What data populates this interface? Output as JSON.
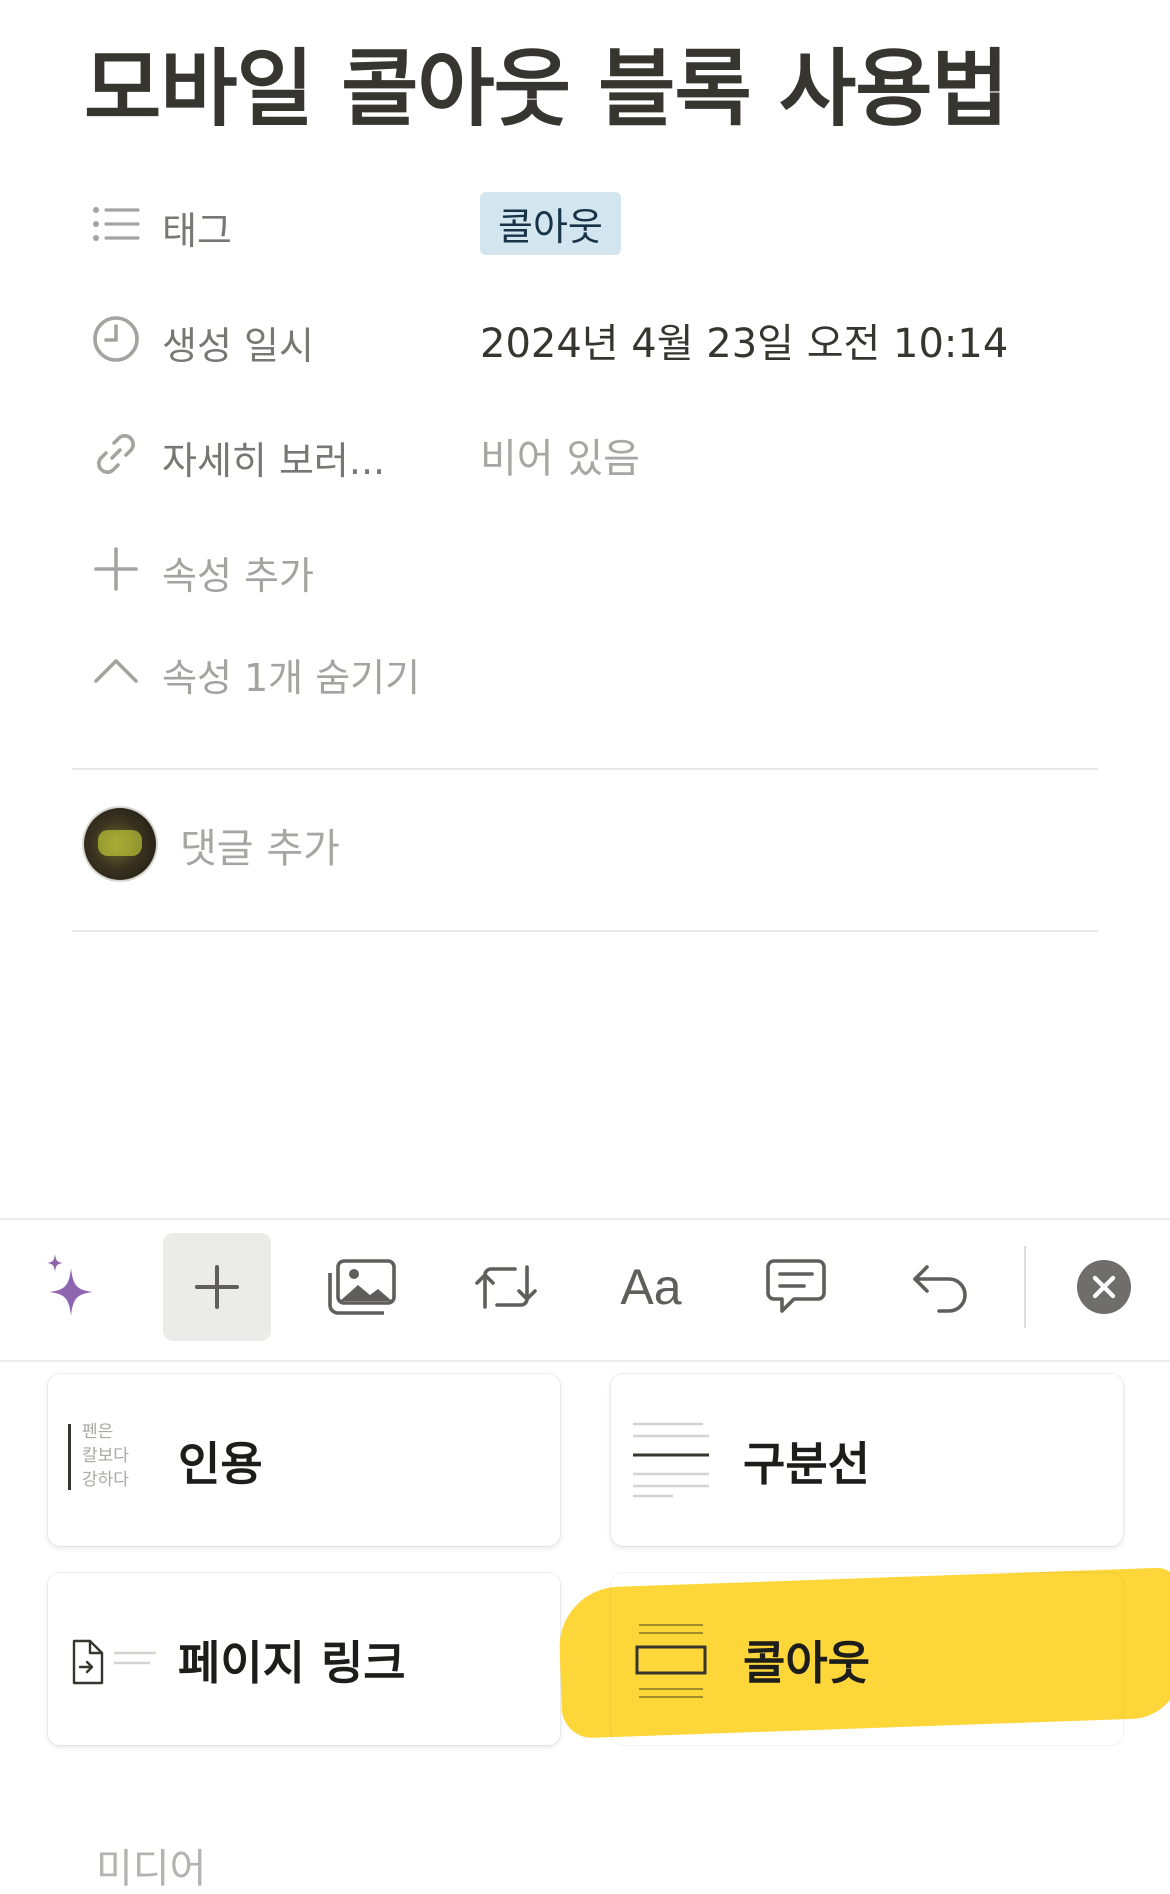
{
  "page": {
    "title": "모바일 콜아웃 블록 사용법"
  },
  "properties": [
    {
      "icon": "list-icon",
      "label": "태그",
      "value": "콜아웃",
      "kind": "tag",
      "tag_color": "#d3e5ef"
    },
    {
      "icon": "clock-icon",
      "label": "생성 일시",
      "value": "2024년 4월 23일 오전 10:14",
      "kind": "text"
    },
    {
      "icon": "link-icon",
      "label": "자세히 보러...",
      "value": "비어 있음",
      "kind": "empty"
    }
  ],
  "actions": {
    "add_property": "속성 추가",
    "hide_properties": "속성 1개 숨기기"
  },
  "comment": {
    "placeholder": "댓글 추가"
  },
  "toolbar": {
    "items": [
      {
        "icon": "ai-sparkle-icon",
        "active": false
      },
      {
        "icon": "plus-icon",
        "active": true
      },
      {
        "icon": "image-icon",
        "active": false
      },
      {
        "icon": "turn-into-icon",
        "active": false
      },
      {
        "icon": "text-style-icon",
        "label": "Aa",
        "active": false
      },
      {
        "icon": "comment-icon",
        "active": false
      },
      {
        "icon": "undo-icon",
        "active": false
      },
      {
        "icon": "close-icon",
        "active": false
      }
    ]
  },
  "blocks": [
    {
      "label": "인용",
      "preview_lines": [
        "펜은",
        "칼보다",
        "강하다"
      ],
      "icon": "quote-preview-icon"
    },
    {
      "label": "구분선",
      "icon": "divider-preview-icon"
    },
    {
      "label": "페이지 링크",
      "icon": "page-link-preview-icon"
    },
    {
      "label": "콜아웃",
      "icon": "callout-preview-icon",
      "highlighted": true,
      "highlight_color": "#fdd42e"
    }
  ],
  "section_heading": "미디어",
  "colors": {
    "accent_ai": "#9065b0",
    "text": "#37352f",
    "muted": "#787774"
  }
}
